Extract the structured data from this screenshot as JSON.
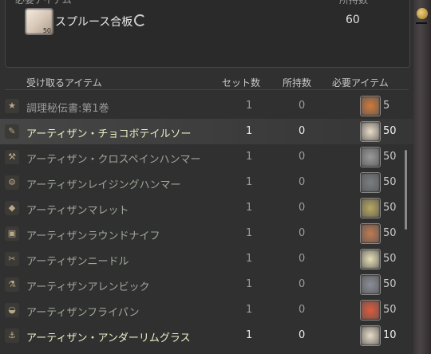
{
  "required": {
    "header_left": "必要アイテム",
    "header_right": "所持数",
    "item_name": "スプルース合板",
    "item_badge": "50",
    "owned": "60"
  },
  "columns": {
    "receive": "受け取るアイテム",
    "sets": "セット数",
    "owned": "所持数",
    "required": "必要アイテム"
  },
  "rows": [
    {
      "cat": "★",
      "name": "調理秘伝書:第1巻",
      "sets": "1",
      "owned": "0",
      "req": "5",
      "mat_icon": "dish-icon",
      "mat_color": "#d07a3a",
      "state": "gray"
    },
    {
      "cat": "✎",
      "name": "アーティザン・チョコボテイルソー",
      "sets": "1",
      "owned": "0",
      "req": "50",
      "mat_icon": "lumber-icon",
      "mat_color": "#e8dcc8",
      "state": "hl sel"
    },
    {
      "cat": "⚒",
      "name": "アーティザン・クロスペインハンマー",
      "sets": "1",
      "owned": "0",
      "req": "50",
      "mat_icon": "wrench-icon",
      "mat_color": "#9a9a9a",
      "state": ""
    },
    {
      "cat": "⚙",
      "name": "アーティザンレイジングハンマー",
      "sets": "1",
      "owned": "0",
      "req": "50",
      "mat_icon": "ingot-icon",
      "mat_color": "#7a7e82",
      "state": ""
    },
    {
      "cat": "◆",
      "name": "アーティザンマレット",
      "sets": "1",
      "owned": "0",
      "req": "50",
      "mat_icon": "herb-icon",
      "mat_color": "#b8a860",
      "state": ""
    },
    {
      "cat": "▣",
      "name": "アーティザンラウンドナイフ",
      "sets": "1",
      "owned": "0",
      "req": "50",
      "mat_icon": "leather-icon",
      "mat_color": "#c07a52",
      "state": ""
    },
    {
      "cat": "✂",
      "name": "アーティザンニードル",
      "sets": "1",
      "owned": "0",
      "req": "50",
      "mat_icon": "cloth-icon",
      "mat_color": "#e8e0b8",
      "state": ""
    },
    {
      "cat": "⚗",
      "name": "アーティザンアレンビック",
      "sets": "1",
      "owned": "0",
      "req": "50",
      "mat_icon": "rod-icon",
      "mat_color": "#8a8e96",
      "state": ""
    },
    {
      "cat": "◒",
      "name": "アーティザンフライパン",
      "sets": "1",
      "owned": "0",
      "req": "50",
      "mat_icon": "dish-icon",
      "mat_color": "#e05a3a",
      "state": ""
    },
    {
      "cat": "⚓",
      "name": "アーティザン・アンダーリムグラス",
      "sets": "1",
      "owned": "0",
      "req": "10",
      "mat_icon": "lumber-icon",
      "mat_color": "#e8dcc8",
      "state": "hl"
    }
  ]
}
